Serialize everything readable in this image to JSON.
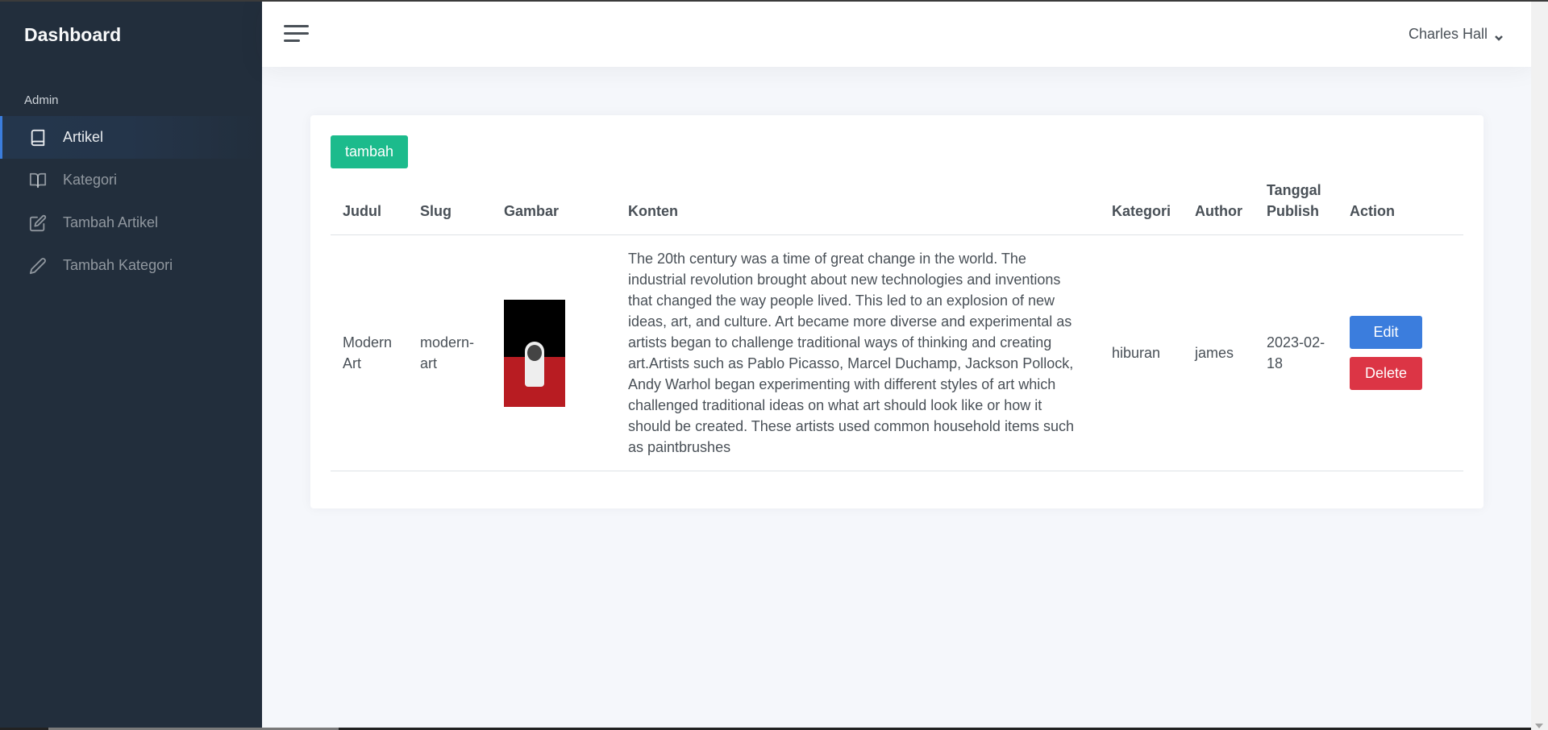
{
  "sidebar": {
    "brand": "Dashboard",
    "header": "Admin",
    "items": [
      {
        "label": "Artikel",
        "icon": "book-icon",
        "active": true
      },
      {
        "label": "Kategori",
        "icon": "book-open-icon",
        "active": false
      },
      {
        "label": "Tambah Artikel",
        "icon": "edit-icon",
        "active": false
      },
      {
        "label": "Tambah Kategori",
        "icon": "pen-icon",
        "active": false
      }
    ]
  },
  "navbar": {
    "user_name": "Charles Hall"
  },
  "card": {
    "add_button": "tambah",
    "columns": [
      "Judul",
      "Slug",
      "Gambar",
      "Konten",
      "Kategori",
      "Author",
      "Tanggal Publish",
      "Action"
    ],
    "rows": [
      {
        "judul": "Modern Art",
        "slug": "modern-art",
        "konten": "The 20th century was a time of great change in the world. The industrial revolution brought about new technologies and inventions that changed the way people lived. This led to an explosion of new ideas, art, and culture. Art became more diverse and experimental as artists began to challenge traditional ways of thinking and creating art.Artists such as Pablo Picasso, Marcel Duchamp, Jackson Pollock, Andy Warhol began experimenting with different styles of art which challenged traditional ideas on what art should look like or how it should be created. These artists used common household items such as paintbrushes",
        "kategori": "hiburan",
        "author": "james",
        "tanggal": "2023-02-18",
        "edit_label": "Edit",
        "delete_label": "Delete"
      }
    ]
  },
  "colors": {
    "sidebar_bg": "#222e3c",
    "primary": "#3b7ddd",
    "success": "#1cbb8c",
    "danger": "#dc3545"
  }
}
